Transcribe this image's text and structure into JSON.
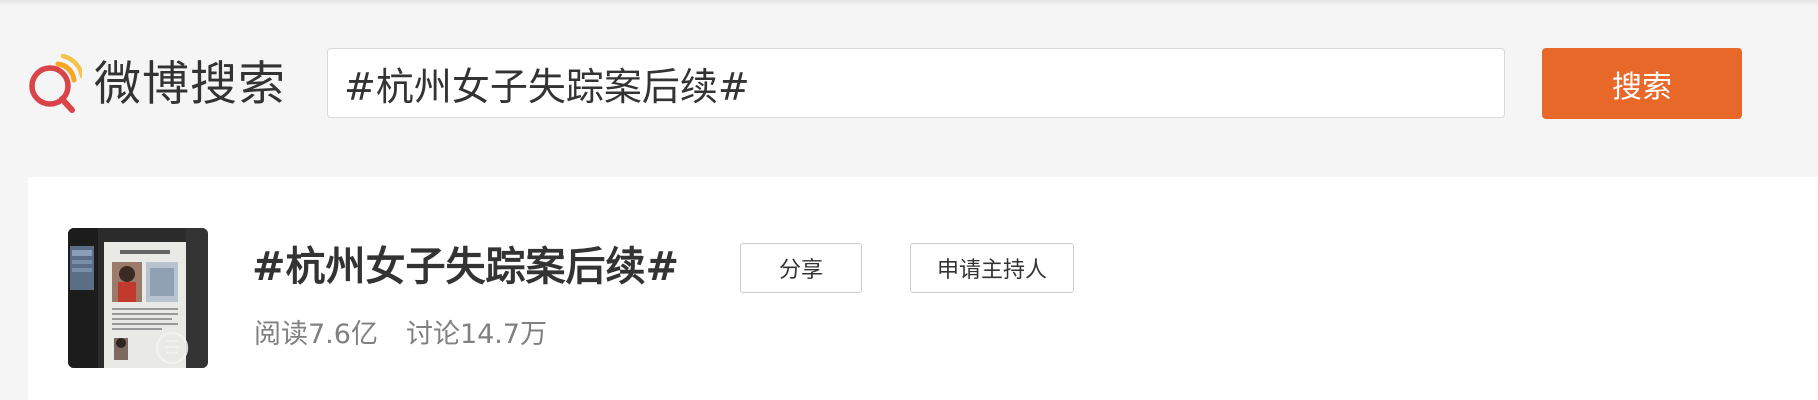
{
  "header": {
    "logo_text": "微博搜索",
    "logo_icon": "weibo-search-icon",
    "search_value": "#杭州女子失踪案后续#",
    "search_button_label": "搜索",
    "accent_color": "#e8682a"
  },
  "topic": {
    "title": "#杭州女子失踪案后续#",
    "share_label": "分享",
    "apply_host_label": "申请主持人",
    "reads": "阅读7.6亿",
    "discussions": "讨论14.7万",
    "thumbnail": "missing-person-notice-photo"
  }
}
